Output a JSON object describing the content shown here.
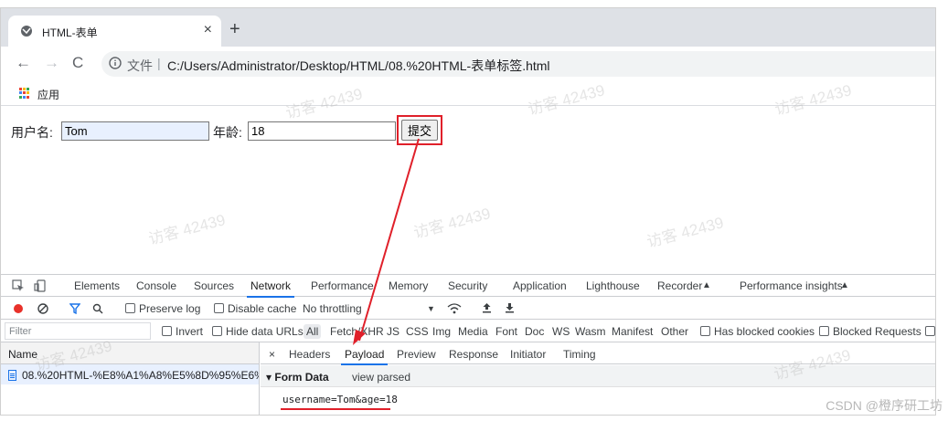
{
  "browser": {
    "tab_title": "HTML-表单",
    "new_tab": "+",
    "tab_close": "×",
    "nav_back": "←",
    "nav_forward": "→",
    "nav_reload": "C",
    "file_label": "文件",
    "separator": "|",
    "url": "C:/Users/Administrator/Desktop/HTML/08.%20HTML-表单标签.html",
    "apps_label": "应用"
  },
  "form": {
    "username_label": "用户名:",
    "username_value": "Tom",
    "age_label": "年龄:",
    "age_value": "18",
    "submit_label": "提交"
  },
  "devtools": {
    "tabs": [
      "Elements",
      "Console",
      "Sources",
      "Network",
      "Performance",
      "Memory",
      "Security",
      "Application",
      "Lighthouse",
      "Recorder",
      "Performance insights"
    ],
    "toolbar": {
      "preserve_log": "Preserve log",
      "disable_cache": "Disable cache",
      "throttling": "No throttling"
    },
    "filter": {
      "placeholder": "Filter",
      "invert": "Invert",
      "hide_data_urls": "Hide data URLs",
      "types": [
        "All",
        "Fetch/XHR",
        "JS",
        "CSS",
        "Img",
        "Media",
        "Font",
        "Doc",
        "WS",
        "Wasm",
        "Manifest",
        "Other"
      ],
      "blocked_cookies": "Has blocked cookies",
      "blocked_requests": "Blocked Requests"
    },
    "requests": {
      "header": "Name",
      "rows": [
        "08.%20HTML-%E8%A1%A8%E5%8D%95%E6%..."
      ]
    },
    "detail": {
      "close": "×",
      "tabs": [
        "Headers",
        "Payload",
        "Preview",
        "Response",
        "Initiator",
        "Timing"
      ],
      "section_title": "▾ Form Data",
      "view_parsed": "view parsed",
      "payload": "username=Tom&age=18"
    }
  },
  "watermark": "访客 42439",
  "credit": "CSDN @橙序研工坊",
  "colors": {
    "accent": "#1a73e8",
    "annotation": "#e0202a",
    "record": "#e8312a"
  }
}
